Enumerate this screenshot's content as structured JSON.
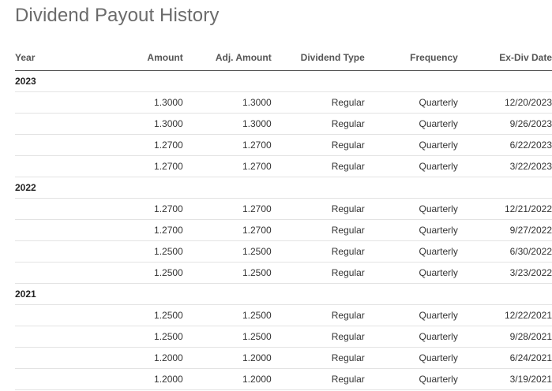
{
  "page": {
    "title": "Dividend Payout History"
  },
  "table": {
    "headers": {
      "year": "Year",
      "amount": "Amount",
      "adj_amount": "Adj. Amount",
      "dividend_type": "Dividend Type",
      "frequency": "Frequency",
      "ex_div_date": "Ex-Div Date"
    },
    "groups": [
      {
        "year": "2023",
        "rows": [
          {
            "amount": "1.3000",
            "adj_amount": "1.3000",
            "type": "Regular",
            "frequency": "Quarterly",
            "ex_div_date": "12/20/2023"
          },
          {
            "amount": "1.3000",
            "adj_amount": "1.3000",
            "type": "Regular",
            "frequency": "Quarterly",
            "ex_div_date": "9/26/2023"
          },
          {
            "amount": "1.2700",
            "adj_amount": "1.2700",
            "type": "Regular",
            "frequency": "Quarterly",
            "ex_div_date": "6/22/2023"
          },
          {
            "amount": "1.2700",
            "adj_amount": "1.2700",
            "type": "Regular",
            "frequency": "Quarterly",
            "ex_div_date": "3/22/2023"
          }
        ]
      },
      {
        "year": "2022",
        "rows": [
          {
            "amount": "1.2700",
            "adj_amount": "1.2700",
            "type": "Regular",
            "frequency": "Quarterly",
            "ex_div_date": "12/21/2022"
          },
          {
            "amount": "1.2700",
            "adj_amount": "1.2700",
            "type": "Regular",
            "frequency": "Quarterly",
            "ex_div_date": "9/27/2022"
          },
          {
            "amount": "1.2500",
            "adj_amount": "1.2500",
            "type": "Regular",
            "frequency": "Quarterly",
            "ex_div_date": "6/30/2022"
          },
          {
            "amount": "1.2500",
            "adj_amount": "1.2500",
            "type": "Regular",
            "frequency": "Quarterly",
            "ex_div_date": "3/23/2022"
          }
        ]
      },
      {
        "year": "2021",
        "rows": [
          {
            "amount": "1.2500",
            "adj_amount": "1.2500",
            "type": "Regular",
            "frequency": "Quarterly",
            "ex_div_date": "12/22/2021"
          },
          {
            "amount": "1.2500",
            "adj_amount": "1.2500",
            "type": "Regular",
            "frequency": "Quarterly",
            "ex_div_date": "9/28/2021"
          },
          {
            "amount": "1.2000",
            "adj_amount": "1.2000",
            "type": "Regular",
            "frequency": "Quarterly",
            "ex_div_date": "6/24/2021"
          },
          {
            "amount": "1.2000",
            "adj_amount": "1.2000",
            "type": "Regular",
            "frequency": "Quarterly",
            "ex_div_date": "3/19/2021"
          }
        ]
      }
    ]
  }
}
